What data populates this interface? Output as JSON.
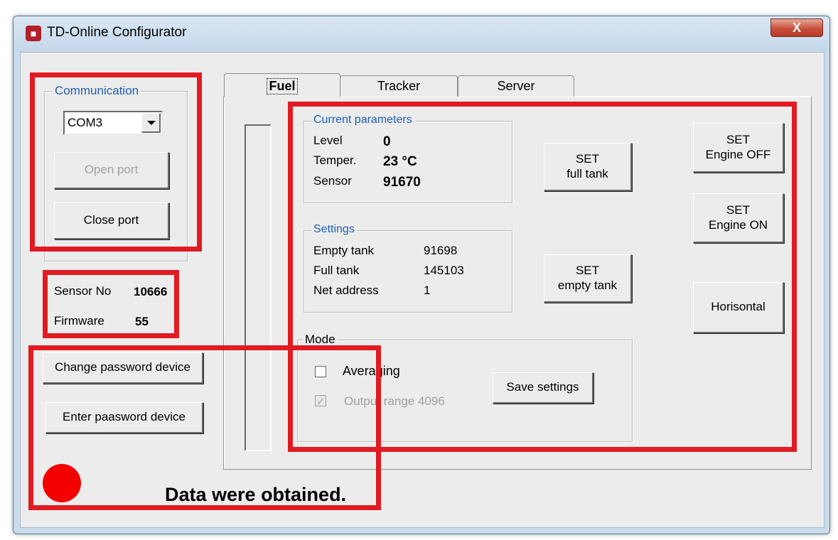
{
  "window": {
    "title": "TD-Online Configurator",
    "close_glyph": "X"
  },
  "communication": {
    "group_title": "Communication",
    "port_selected": "COM3",
    "open_port_label": "Open port",
    "close_port_label": "Close port"
  },
  "device_info": {
    "sensor_no_label": "Sensor No",
    "sensor_no_value": "10666",
    "firmware_label": "Firmware",
    "firmware_value": "55"
  },
  "password": {
    "change_label": "Change password device",
    "enter_label": "Enter paasword device"
  },
  "status": {
    "message": "Data were obtained.",
    "indicator_color": "#f40000"
  },
  "tabs": [
    {
      "label": "Fuel",
      "active": true
    },
    {
      "label": "Tracker",
      "active": false
    },
    {
      "label": "Server",
      "active": false
    }
  ],
  "current_parameters": {
    "group_title": "Current parameters",
    "level_label": "Level",
    "level_value": "0",
    "temper_label": "Temper.",
    "temper_value": "23 °C",
    "sensor_label": "Sensor",
    "sensor_value": "91670"
  },
  "settings": {
    "group_title": "Settings",
    "empty_tank_label": "Empty tank",
    "empty_tank_value": "91698",
    "full_tank_label": "Full tank",
    "full_tank_value": "145103",
    "net_address_label": "Net address",
    "net_address_value": "1"
  },
  "actions": {
    "set_full_tank": [
      "SET",
      "full tank"
    ],
    "set_empty_tank": [
      "SET",
      "empty tank"
    ],
    "set_engine_off": [
      "SET",
      "Engine OFF"
    ],
    "set_engine_on": [
      "SET",
      "Engine ON"
    ],
    "horisontal": "Horisontal"
  },
  "mode": {
    "group_title": "Mode",
    "averaging_label": "Averaging",
    "averaging_checked": false,
    "output_range_label": "Output range 4096",
    "output_range_checked": true,
    "save_label": "Save settings"
  },
  "colors": {
    "highlight": "#e01b22",
    "group_title_blue": "#1f5fb4"
  }
}
